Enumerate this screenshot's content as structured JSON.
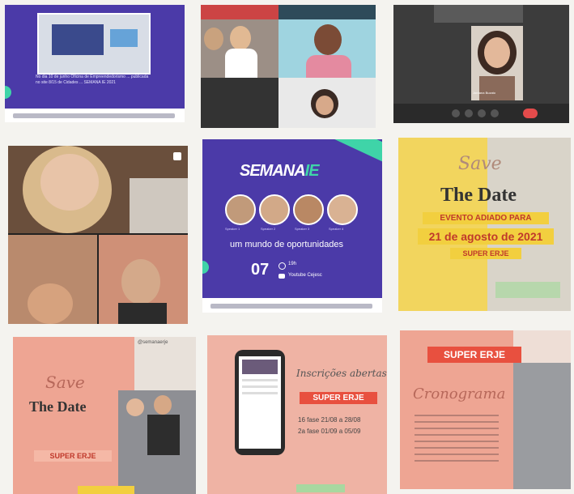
{
  "grid": {
    "tile1": {
      "caption": "No dia 10 de junho Oficina de Empreendedorismo ... publicada no site 8/15 de Cidades ... SEMANA IE 2021"
    },
    "tile3": {
      "participant_name": "Jordana Buzato"
    },
    "tile5": {
      "brand": "SEMANA",
      "brand_suffix": "IE",
      "slogan": "um mundo de oportunidades",
      "date_day": "07",
      "time": "19h",
      "channel": "Youtube Cejesc",
      "speakers": [
        "Speaker 1",
        "Speaker 2",
        "Speaker 3",
        "Speaker 4"
      ]
    },
    "tile6": {
      "save": "Save",
      "the_date": "The Date",
      "line1": "EVENTO ADIADO PARA",
      "line2": "21 de agosto de 2021",
      "badge": "SUPER ERJE"
    },
    "tile7": {
      "account": "@semanaerje",
      "save": "Save",
      "the_date": "The Date",
      "badge": "SUPER ERJE"
    },
    "tile8": {
      "script_title": "Inscrições abertas",
      "badge": "SUPER ERJE",
      "line1": "16 fase 21/08 a 28/08",
      "line2": "2a fase 01/09 a 05/09"
    },
    "tile9": {
      "badge": "SUPER ERJE",
      "script_title": "Cronograma"
    }
  },
  "colors": {
    "purple": "#4b3aa8",
    "teal": "#3fd4a8",
    "salmon": "#eea593",
    "yellow": "#f2cf3f",
    "red": "#e8503f"
  }
}
